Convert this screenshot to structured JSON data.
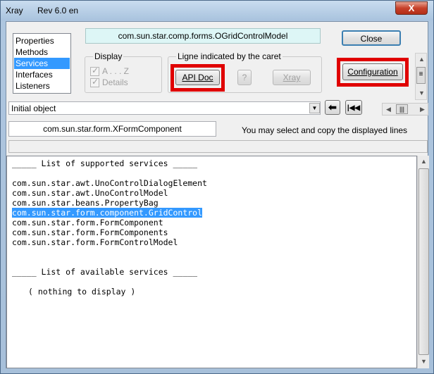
{
  "window": {
    "title": "Xray",
    "version": "Rev 6.0 en",
    "close_glyph": "X"
  },
  "info_list": {
    "items": [
      "Properties",
      "Methods",
      "Services",
      "Interfaces",
      "Listeners"
    ],
    "selected": "Services"
  },
  "object_name": "com.sun.star.comp.forms.OGridControlModel",
  "close_button": "Close",
  "display_group": {
    "label": "Display",
    "options": [
      {
        "label": "A . . . Z",
        "checked": true
      },
      {
        "label": "Details",
        "checked": true
      }
    ]
  },
  "caret_group": {
    "label": "Ligne indicated by the caret",
    "api_doc": "API Doc",
    "help": "?",
    "xray": "Xray"
  },
  "configuration_button": "Configuration",
  "object_select": {
    "value": "Initial object"
  },
  "nav": {
    "back_icon": "arrow-left-icon",
    "first_icon": "skip-to-start-icon"
  },
  "interface_field": "com.sun.star.form.XFormComponent",
  "hint": "You may select and copy the displayed lines",
  "content": {
    "supported_header": "_____ List of supported services _____",
    "supported": [
      "com.sun.star.awt.UnoControlDialogElement",
      "com.sun.star.awt.UnoControlModel",
      "com.sun.star.beans.PropertyBag",
      "com.sun.star.form.component.GridControl",
      "com.sun.star.form.FormComponent",
      "com.sun.star.form.FormComponents",
      "com.sun.star.form.FormControlModel"
    ],
    "selected_line": "com.sun.star.form.component.GridControl",
    "available_header": "_____ List of available services _____",
    "available_empty": "( nothing to display )"
  },
  "colors": {
    "selection": "#3399ff",
    "highlight_box": "#e00000"
  }
}
